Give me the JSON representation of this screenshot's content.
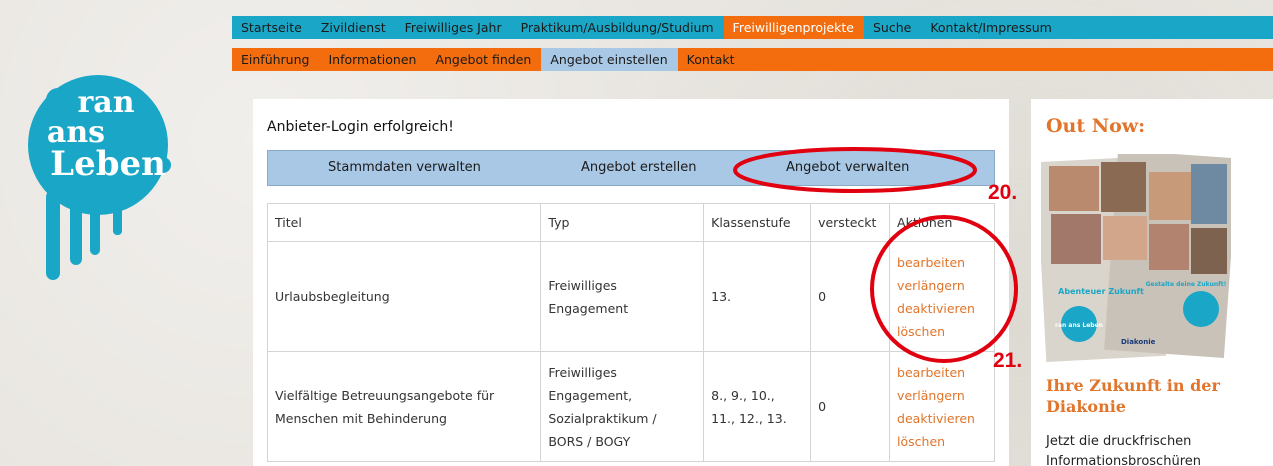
{
  "logo": {
    "lines": [
      "ran",
      "ans",
      "Leben"
    ]
  },
  "nav_primary": {
    "items": [
      {
        "label": "Startseite",
        "active": false
      },
      {
        "label": "Zivildienst",
        "active": false
      },
      {
        "label": "Freiwilliges Jahr",
        "active": false
      },
      {
        "label": "Praktikum/Ausbildung/Studium",
        "active": false
      },
      {
        "label": "Freiwilligenprojekte",
        "active": true
      },
      {
        "label": "Suche",
        "active": false
      },
      {
        "label": "Kontakt/Impressum",
        "active": false
      }
    ]
  },
  "nav_secondary": {
    "items": [
      {
        "label": "Einführung",
        "active": false
      },
      {
        "label": "Informationen",
        "active": false
      },
      {
        "label": "Angebot finden",
        "active": false
      },
      {
        "label": "Angebot einstellen",
        "active": true
      },
      {
        "label": "Kontakt",
        "active": false
      }
    ]
  },
  "main": {
    "title": "Anbieter-Login erfolgreich!",
    "tabs": [
      "Stammdaten verwalten",
      "Angebot erstellen",
      "Angebot verwalten"
    ],
    "table": {
      "headers": [
        "Titel",
        "Typ",
        "Klassenstufe",
        "versteckt",
        "Aktionen"
      ],
      "rows": [
        {
          "title": [
            "Urlaubsbegleitung"
          ],
          "type": [
            "Freiwilliges",
            "Engagement"
          ],
          "grade": [
            "13."
          ],
          "hidden": "0",
          "actions": [
            "bearbeiten",
            "verlängern",
            "deaktivieren",
            "löschen"
          ]
        },
        {
          "title": [
            "Vielfältige Betreuungsangebote für",
            "Menschen mit Behinderung"
          ],
          "type": [
            "Freiwilliges",
            "Engagement,",
            "Sozialpraktikum /",
            "BORS / BOGY"
          ],
          "grade": [
            "8., 9., 10.,",
            "11., 12., 13."
          ],
          "hidden": "0",
          "actions": [
            "bearbeiten",
            "verlängern",
            "deaktivieren",
            "löschen"
          ]
        }
      ]
    }
  },
  "sidebar": {
    "heading": "Out Now:",
    "brochure_text": [
      "Abenteuer Zukunft",
      "Gestalte deine Zukunft!",
      "ran ans Leben",
      "Diakonie"
    ],
    "subheading_lines": [
      "Ihre Zukunft in der",
      "Diakonie"
    ],
    "text_lines": [
      "Jetzt die druckfrischen",
      "Informationsbroschüren"
    ]
  },
  "annotations": {
    "labels": [
      "20.",
      "21."
    ],
    "color": "#e00010"
  },
  "colors": {
    "nav_primary_bg": "#1aa6c6",
    "nav_secondary_bg": "#f36d0f",
    "tab_bar_bg": "#a8c8e6",
    "action_link": "#e0752b",
    "logo": "#1aa6c6"
  }
}
